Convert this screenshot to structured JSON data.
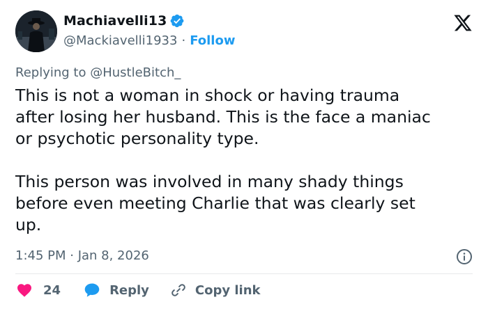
{
  "author": {
    "display_name": "Machiavelli13",
    "handle": "@Mackiavelli1933",
    "separator": "·",
    "follow_label": "Follow"
  },
  "reply_to": {
    "prefix": "Replying to ",
    "mention": "@HustleBitch_"
  },
  "tweet": {
    "text": "This is not a woman in shock or having trauma\nafter losing her husband. This is the face a maniac\nor psychotic personality type.\n\nThis person was involved in many shady things\nbefore even meeting Charlie that was clearly set\nup.",
    "timestamp": "1:45 PM · Jan 8, 2026"
  },
  "actions": {
    "like_count": "24",
    "reply_label": "Reply",
    "copy_label": "Copy link"
  },
  "icons": {
    "verified": "verified-badge-icon",
    "x_logo": "x-logo-icon",
    "info": "info-icon",
    "like": "heart-icon",
    "reply": "reply-bubble-icon",
    "copy": "link-icon"
  },
  "colors": {
    "accent": "#1d9bf0",
    "like": "#f91880",
    "secondary_text": "#536471",
    "primary_text": "#0f1419",
    "divider": "#e7e9ea"
  }
}
